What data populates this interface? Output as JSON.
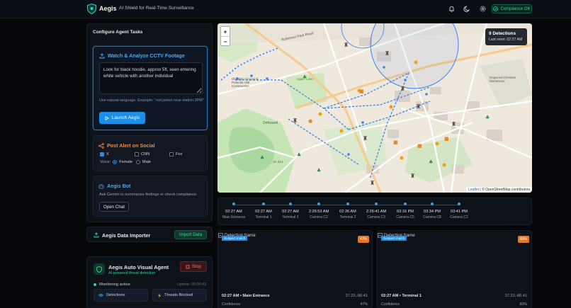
{
  "header": {
    "brand": "Aegis",
    "tagline": "AI Shield for Real-Time Surveillance",
    "compliance": "Compliance OK"
  },
  "tasks": {
    "title": "Configure Agent Tasks",
    "cctv": {
      "title": "Watch & Analyze CCTV Footage",
      "prompt": "Look for black hoodie, approx 5ft, seen entering white vehicle with another individual",
      "hint": "Use natural language. Example: \"red jacket near station 3PM\"",
      "button": "Launch Aegis"
    },
    "social": {
      "title": "Post Alert on Social",
      "options": [
        {
          "label": "X",
          "checked": true
        },
        {
          "label": "CNN",
          "checked": false
        },
        {
          "label": "Fox",
          "checked": false
        }
      ],
      "voice_label": "Voice:",
      "voices": [
        {
          "label": "Female",
          "selected": true
        },
        {
          "label": "Male",
          "selected": false
        }
      ]
    },
    "bot": {
      "title": "Aegis Bot",
      "desc": "Ask Gemini to summarize findings or check compliance.",
      "button": "Open Chat"
    }
  },
  "importer": {
    "title": "Aegis Data Importer",
    "button": "Import Data"
  },
  "agent": {
    "title": "Aegis Auto Visual Agent",
    "subtitle": "AI-powered threat detection",
    "stop": "Stop",
    "status": "Monitoring active",
    "uptime": "Uptime: 00:00:43",
    "detections_label": "Detections",
    "threats_label": "Threats Blocked"
  },
  "map": {
    "detections": "9 Detections",
    "last_seen": "Last seen: 02:27 AM",
    "zoom_in": "+",
    "zoom_out": "−",
    "attribution_leaflet": "Leaflet",
    "attribution": "| © OpenStreetMap contributors",
    "labels": {
      "robinson": "Robinson Park Road",
      "oldmain": "Old Main Ground & Rotunda Hall Construction",
      "driftwood": "Driftwood",
      "upper": "Upper Lawn",
      "dogwood": "Dogwood Christian Montessori",
      "va314": "VA 314"
    }
  },
  "timeline": [
    {
      "time": "02:27 AM",
      "camera": "Main Entrance"
    },
    {
      "time": "02:27 AM",
      "camera": "Terminal 1"
    },
    {
      "time": "02:27 AM",
      "camera": "Terminal 2"
    },
    {
      "time": "2:26:53 AM",
      "camera": "Camera C2"
    },
    {
      "time": "02:26 AM",
      "camera": "Terminal 2"
    },
    {
      "time": "2:26:41 AM",
      "camera": "Camera C3"
    },
    {
      "time": "03:16 PM",
      "camera": "Camera C5"
    },
    {
      "time": "03:34 PM",
      "camera": "Camera C8"
    },
    {
      "time": "03:41 PM",
      "camera": "Camera C2"
    }
  ],
  "feeds": [
    {
      "broken": "Detection frame",
      "badge": "Suspect match",
      "pct": "47%",
      "title": "02:27 AM • Main Entrance",
      "coords": "37.23,-80.41",
      "conf_label": "Confidence",
      "conf": "47%"
    },
    {
      "broken": "Detection frame",
      "badge": "Suspect match",
      "pct": "83%",
      "title": "02:27 AM • Terminal 1",
      "coords": "37.23,-80.41",
      "conf_label": "Confidence",
      "conf": "83%"
    }
  ],
  "colors": {
    "accent": "#1d8fe8",
    "success": "#34d399",
    "danger": "#f87171",
    "warning": "#e8771d"
  }
}
